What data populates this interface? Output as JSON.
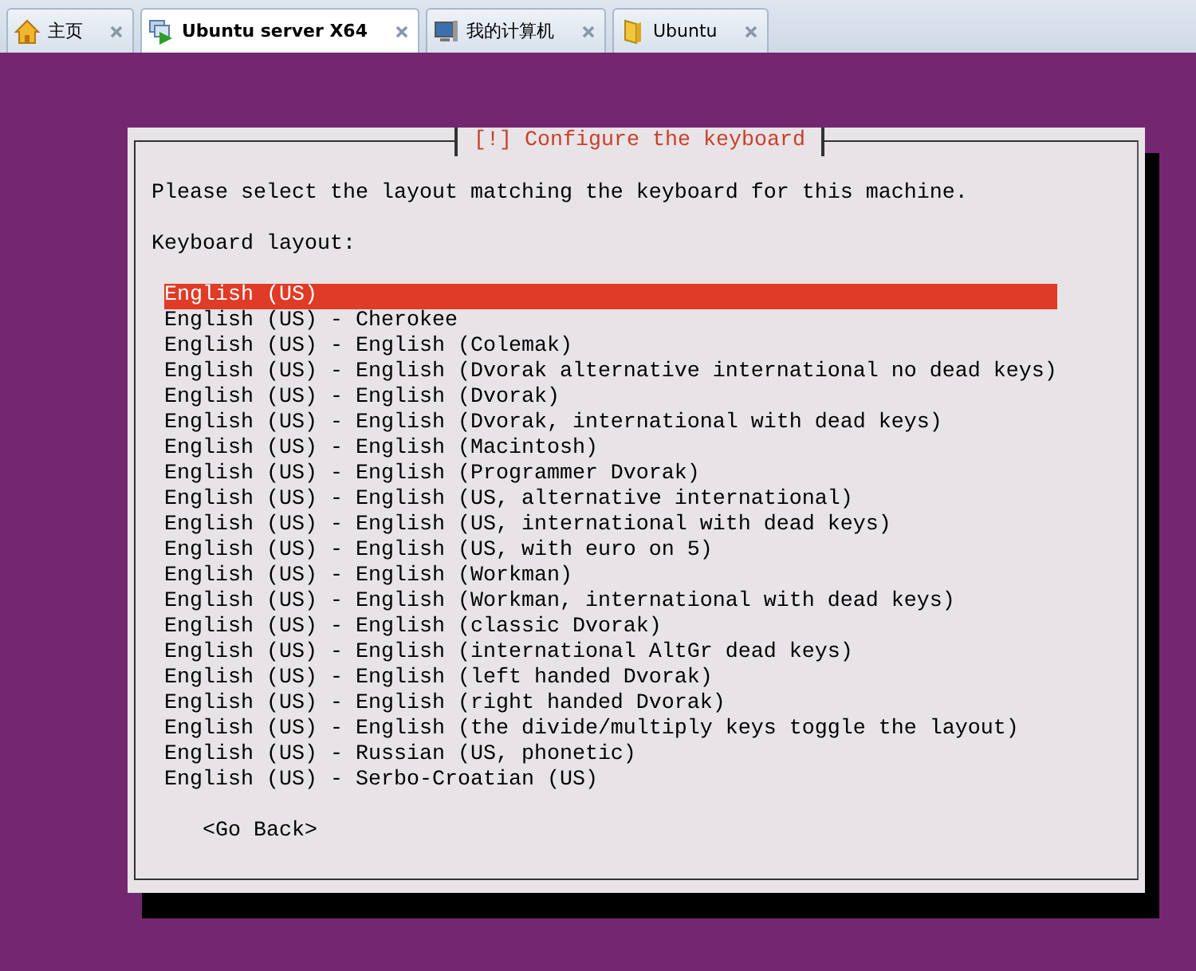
{
  "tabs": [
    {
      "label": "主页",
      "selected": false
    },
    {
      "label": "Ubuntu server X64",
      "selected": true
    },
    {
      "label": "我的计算机",
      "selected": false
    },
    {
      "label": "Ubuntu",
      "selected": false
    }
  ],
  "dialog": {
    "title": "[!] Configure the keyboard",
    "prompt": "Please select the layout matching the keyboard for this machine.",
    "list_label": "Keyboard layout:",
    "layouts": [
      {
        "label": "English (US)",
        "selected": true
      },
      {
        "label": "English (US) - Cherokee",
        "selected": false
      },
      {
        "label": "English (US) - English (Colemak)",
        "selected": false
      },
      {
        "label": "English (US) - English (Dvorak alternative international no dead keys)",
        "selected": false
      },
      {
        "label": "English (US) - English (Dvorak)",
        "selected": false
      },
      {
        "label": "English (US) - English (Dvorak, international with dead keys)",
        "selected": false
      },
      {
        "label": "English (US) - English (Macintosh)",
        "selected": false
      },
      {
        "label": "English (US) - English (Programmer Dvorak)",
        "selected": false
      },
      {
        "label": "English (US) - English (US, alternative international)",
        "selected": false
      },
      {
        "label": "English (US) - English (US, international with dead keys)",
        "selected": false
      },
      {
        "label": "English (US) - English (US, with euro on 5)",
        "selected": false
      },
      {
        "label": "English (US) - English (Workman)",
        "selected": false
      },
      {
        "label": "English (US) - English (Workman, international with dead keys)",
        "selected": false
      },
      {
        "label": "English (US) - English (classic Dvorak)",
        "selected": false
      },
      {
        "label": "English (US) - English (international AltGr dead keys)",
        "selected": false
      },
      {
        "label": "English (US) - English (left handed Dvorak)",
        "selected": false
      },
      {
        "label": "English (US) - English (right handed Dvorak)",
        "selected": false
      },
      {
        "label": "English (US) - English (the divide/multiply keys toggle the layout)",
        "selected": false
      },
      {
        "label": "English (US) - Russian (US, phonetic)",
        "selected": false
      },
      {
        "label": "English (US) - Serbo-Croatian (US)",
        "selected": false
      }
    ],
    "back_button": "<Go Back>"
  }
}
